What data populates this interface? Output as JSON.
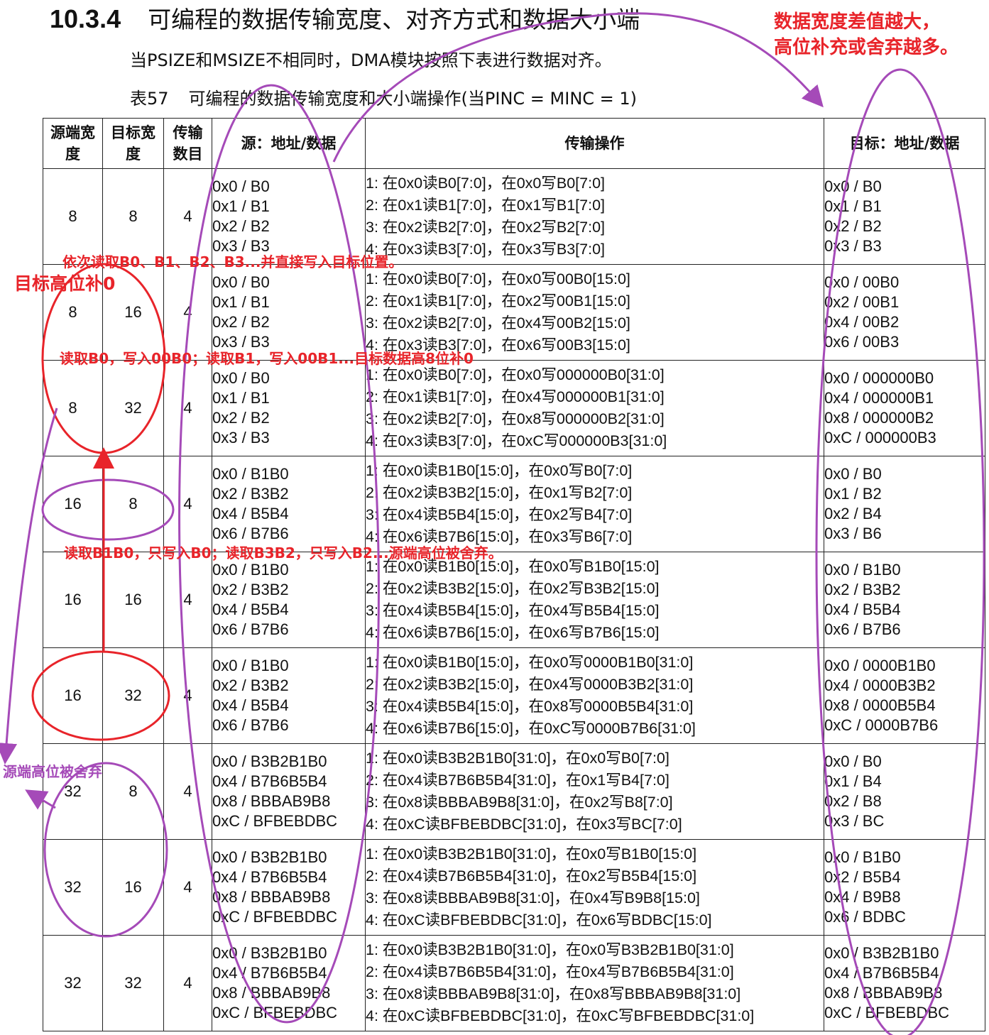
{
  "section": {
    "number": "10.3.4",
    "title": "可编程的数据传输宽度、对齐方式和数据大小端"
  },
  "intro": "当PSIZE和MSIZE不相同时，DMA模块按照下表进行数据对齐。",
  "table_caption": {
    "label": "表57",
    "text": "可编程的数据传输宽度和大小端操作(当PINC = MINC = 1)"
  },
  "table": {
    "headers": [
      "源端宽度",
      "目标宽度",
      "传输数目",
      "源：地址/数据",
      "传输操作",
      "目标：地址/数据"
    ],
    "rows": [
      {
        "src_width": "8",
        "dst_width": "8",
        "count": "4",
        "source": [
          "0x0 / B0",
          "0x1 / B1",
          "0x2 / B2",
          "0x3 / B3"
        ],
        "ops": [
          "1: 在0x0读B0[7:0]，在0x0写B0[7:0]",
          "2: 在0x1读B1[7:0]，在0x1写B1[7:0]",
          "3: 在0x2读B2[7:0]，在0x2写B2[7:0]",
          "4: 在0x3读B3[7:0]，在0x3写B3[7:0]"
        ],
        "target": [
          "0x0 / B0",
          "0x1 / B1",
          "0x2 / B2",
          "0x3 / B3"
        ]
      },
      {
        "src_width": "8",
        "dst_width": "16",
        "count": "4",
        "source": [
          "0x0 / B0",
          "0x1 / B1",
          "0x2 / B2",
          "0x3 / B3"
        ],
        "ops": [
          "1: 在0x0读B0[7:0]，在0x0写00B0[15:0]",
          "2: 在0x1读B1[7:0]，在0x2写00B1[15:0]",
          "3: 在0x2读B2[7:0]，在0x4写00B2[15:0]",
          "4: 在0x3读B3[7:0]，在0x6写00B3[15:0]"
        ],
        "target": [
          "0x0 / 00B0",
          "0x2 / 00B1",
          "0x4 / 00B2",
          "0x6 / 00B3"
        ]
      },
      {
        "src_width": "8",
        "dst_width": "32",
        "count": "4",
        "source": [
          "0x0 / B0",
          "0x1 / B1",
          "0x2 / B2",
          "0x3 / B3"
        ],
        "ops": [
          "1: 在0x0读B0[7:0]，在0x0写000000B0[31:0]",
          "2: 在0x1读B1[7:0]，在0x4写000000B1[31:0]",
          "3: 在0x2读B2[7:0]，在0x8写000000B2[31:0]",
          "4: 在0x3读B3[7:0]，在0xC写000000B3[31:0]"
        ],
        "target": [
          "0x0 / 000000B0",
          "0x4 / 000000B1",
          "0x8 / 000000B2",
          "0xC / 000000B3"
        ]
      },
      {
        "src_width": "16",
        "dst_width": "8",
        "count": "4",
        "source": [
          "0x0 / B1B0",
          "0x2 / B3B2",
          "0x4 / B5B4",
          "0x6 / B7B6"
        ],
        "ops": [
          "1: 在0x0读B1B0[15:0]，在0x0写B0[7:0]",
          "2: 在0x2读B3B2[15:0]，在0x1写B2[7:0]",
          "3: 在0x4读B5B4[15:0]，在0x2写B4[7:0]",
          "4: 在0x6读B7B6[15:0]，在0x3写B6[7:0]"
        ],
        "target": [
          "0x0 / B0",
          "0x1 / B2",
          "0x2 / B4",
          "0x3 / B6"
        ]
      },
      {
        "src_width": "16",
        "dst_width": "16",
        "count": "4",
        "source": [
          "0x0 / B1B0",
          "0x2 / B3B2",
          "0x4 / B5B4",
          "0x6 / B7B6"
        ],
        "ops": [
          "1: 在0x0读B1B0[15:0]，在0x0写B1B0[15:0]",
          "2: 在0x2读B3B2[15:0]，在0x2写B3B2[15:0]",
          "3: 在0x4读B5B4[15:0]，在0x4写B5B4[15:0]",
          "4: 在0x6读B7B6[15:0]，在0x6写B7B6[15:0]"
        ],
        "target": [
          "0x0 / B1B0",
          "0x2 / B3B2",
          "0x4 / B5B4",
          "0x6 / B7B6"
        ]
      },
      {
        "src_width": "16",
        "dst_width": "32",
        "count": "4",
        "source": [
          "0x0 / B1B0",
          "0x2 / B3B2",
          "0x4 / B5B4",
          "0x6 / B7B6"
        ],
        "ops": [
          "1: 在0x0读B1B0[15:0]，在0x0写0000B1B0[31:0]",
          "2: 在0x2读B3B2[15:0]，在0x4写0000B3B2[31:0]",
          "3: 在0x4读B5B4[15:0]，在0x8写0000B5B4[31:0]",
          "4: 在0x6读B7B6[15:0]，在0xC写0000B7B6[31:0]"
        ],
        "target": [
          "0x0 / 0000B1B0",
          "0x4 / 0000B3B2",
          "0x8 / 0000B5B4",
          "0xC / 0000B7B6"
        ]
      },
      {
        "src_width": "32",
        "dst_width": "8",
        "count": "4",
        "source": [
          "0x0 / B3B2B1B0",
          "0x4 / B7B6B5B4",
          "0x8 / BBBAB9B8",
          "0xC / BFBEBDBC"
        ],
        "ops": [
          "1: 在0x0读B3B2B1B0[31:0]，在0x0写B0[7:0]",
          "2: 在0x4读B7B6B5B4[31:0]，在0x1写B4[7:0]",
          "3: 在0x8读BBBAB9B8[31:0]，在0x2写B8[7:0]",
          "4: 在0xC读BFBEBDBC[31:0]，在0x3写BC[7:0]"
        ],
        "target": [
          "0x0 / B0",
          "0x1 / B4",
          "0x2 / B8",
          "0x3 / BC"
        ]
      },
      {
        "src_width": "32",
        "dst_width": "16",
        "count": "4",
        "source": [
          "0x0 / B3B2B1B0",
          "0x4 / B7B6B5B4",
          "0x8 / BBBAB9B8",
          "0xC / BFBEBDBC"
        ],
        "ops": [
          "1: 在0x0读B3B2B1B0[31:0]，在0x0写B1B0[15:0]",
          "2: 在0x4读B7B6B5B4[31:0]，在0x2写B5B4[15:0]",
          "3: 在0x8读BBBAB9B8[31:0]，在0x4写B9B8[15:0]",
          "4: 在0xC读BFBEBDBC[31:0]，在0x6写BDBC[15:0]"
        ],
        "target": [
          "0x0 / B1B0",
          "0x2 / B5B4",
          "0x4 / B9B8",
          "0x6 / BDBC"
        ]
      },
      {
        "src_width": "32",
        "dst_width": "32",
        "count": "4",
        "source": [
          "0x0 / B3B2B1B0",
          "0x4 / B7B6B5B4",
          "0x8 / BBBAB9B8",
          "0xC / BFBEBDBC"
        ],
        "ops": [
          "1: 在0x0读B3B2B1B0[31:0]，在0x0写B3B2B1B0[31:0]",
          "2: 在0x4读B7B6B5B4[31:0]，在0x4写B7B6B5B4[31:0]",
          "3: 在0x8读BBBAB9B8[31:0]，在0x8写BBBAB9B8[31:0]",
          "4: 在0xC读BFBEBDBC[31:0]，在0xC写BFBEBDBC[31:0]"
        ],
        "target": [
          "0x0 / B3B2B1B0",
          "0x4 / B7B6B5B4",
          "0x8 / BBBAB9B8",
          "0xC / BFBEBDBC"
        ]
      }
    ]
  },
  "annotations": {
    "top_right_line1": "数据宽度差值越大，",
    "top_right_line2": "高位补充或舍弃越多。",
    "read_direct": "依次读取B0、B1、B2、B3...并直接写入目标位置。",
    "target_high_zero": "目标高位补0",
    "read_pad": "读取B0，写入00B0；读取B1，写入00B1...目标数据高8位补0",
    "read_discard": "读取B1B0，只写入B0；读取B3B2，只写入B2...源端高位被舍弃。",
    "source_high_discarded": "源端高位被舍弃",
    "colors": {
      "red": "#e8242a",
      "purple": "#a54ab8"
    }
  }
}
